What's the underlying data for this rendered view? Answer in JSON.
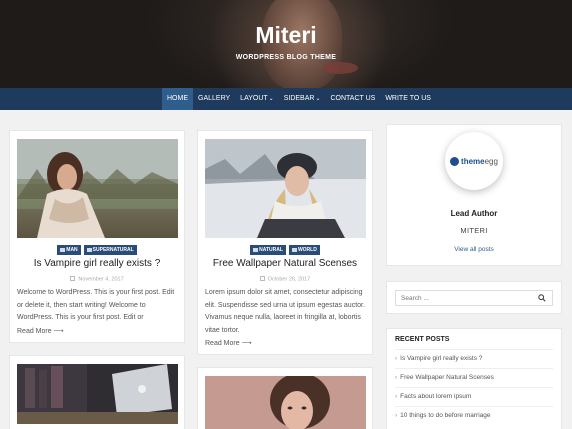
{
  "site": {
    "title": "Miteri",
    "description": "WORDPRESS BLOG THEME"
  },
  "nav": [
    {
      "label": "HOME"
    },
    {
      "label": "GALLERY"
    },
    {
      "label": "LAYOUT"
    },
    {
      "label": "SIDEBAR"
    },
    {
      "label": "CONTACT US"
    },
    {
      "label": "WRITE TO US"
    }
  ],
  "nav_dropdown_marker": "⌄",
  "posts": [
    {
      "categories": [
        "MAN",
        "SUPERNATURAL"
      ],
      "title": "Is Vampire girl really exists ?",
      "date": "November 4, 2017",
      "excerpt": "Welcome to WordPress. This is your first post. Edit or delete it, then start writing! Welcome to WordPress. This is your first post. Edit or",
      "read_more": "Read More"
    },
    {
      "categories": [
        "NATURAL",
        "WORLD"
      ],
      "title": "Free Wallpaper Natural Scenses",
      "date": "October 26, 2017",
      "excerpt": "Lorem ipsum dolor sit amet, consectetur adipiscing elit. Suspendisse sed urna ut ipsum egestas auctor. Vivamus neque nulla, laoreet in fringilla at, lobortis vitae tortor.",
      "read_more": "Read More"
    }
  ],
  "author_widget": {
    "logo_text": "theme",
    "logo_text_suffix": "egg",
    "heading": "Lead Author",
    "name": "MITERI",
    "link": "View all posts"
  },
  "search": {
    "placeholder": "Search ..."
  },
  "recent_posts": {
    "title": "RECENT POSTS",
    "items": [
      "Is Vampire girl really exists ?",
      "Free Wallpaper Natural Scenses",
      "Facts about lorem ipsum",
      "10 things to do before marriage"
    ]
  },
  "colors": {
    "nav_bg": "#1e3a5c",
    "nav_active": "#2f5d8c",
    "category_badge": "#2a4c78",
    "link": "#2f5d8c"
  }
}
